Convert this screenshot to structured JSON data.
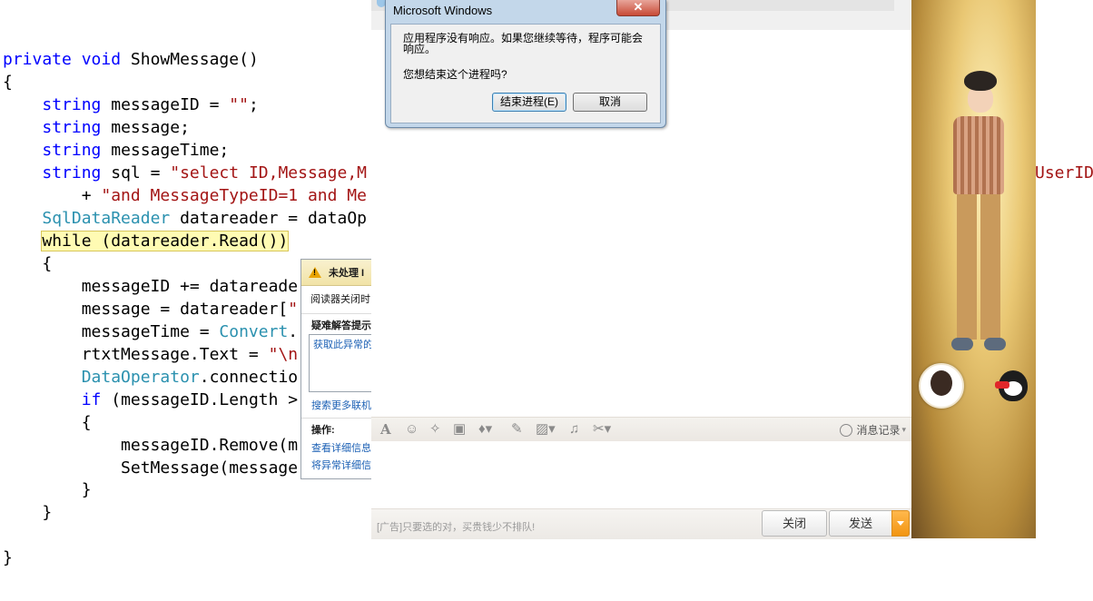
{
  "code": {
    "lines": [
      [
        {
          "t": "private",
          "c": "kw"
        },
        {
          "t": " "
        },
        {
          "t": "void",
          "c": "kw"
        },
        {
          "t": " ShowMessage()"
        }
      ],
      [
        {
          "t": "{"
        }
      ],
      [
        {
          "t": "    "
        },
        {
          "t": "string",
          "c": "kw"
        },
        {
          "t": " messageID = "
        },
        {
          "t": "\"\"",
          "c": "st"
        },
        {
          "t": ";"
        }
      ],
      [
        {
          "t": "    "
        },
        {
          "t": "string",
          "c": "kw"
        },
        {
          "t": " message;"
        }
      ],
      [
        {
          "t": "    "
        },
        {
          "t": "string",
          "c": "kw"
        },
        {
          "t": " messageTime;"
        }
      ],
      [
        {
          "t": "    "
        },
        {
          "t": "string",
          "c": "kw"
        },
        {
          "t": " sql = "
        },
        {
          "t": "\"select ID,Message,M",
          "c": "st"
        }
      ],
      [
        {
          "t": "        + "
        },
        {
          "t": "\"and MessageTypeID=1 and Me",
          "c": "st"
        }
      ],
      [
        {
          "t": "    "
        },
        {
          "t": "SqlDataReader",
          "c": "ty"
        },
        {
          "t": " datareader = dataOp"
        }
      ],
      [
        {
          "t": "    "
        },
        {
          "t": "while (datareader.Read())",
          "c": "hl"
        }
      ],
      [
        {
          "t": "    {"
        }
      ],
      [
        {
          "t": "        messageID += datareade"
        }
      ],
      [
        {
          "t": "        message = datareader["
        },
        {
          "t": "\"",
          "c": "st"
        }
      ],
      [
        {
          "t": "        messageTime = "
        },
        {
          "t": "Convert",
          "c": "ty"
        },
        {
          "t": "."
        }
      ],
      [
        {
          "t": "        rtxtMessage.Text = "
        },
        {
          "t": "\"\\n",
          "c": "st"
        }
      ],
      [
        {
          "t": "        "
        },
        {
          "t": "DataOperator",
          "c": "ty"
        },
        {
          "t": ".connectio"
        }
      ],
      [
        {
          "t": "        "
        },
        {
          "t": "if",
          "c": "kw"
        },
        {
          "t": " (messageID.Length >"
        }
      ],
      [
        {
          "t": "        {"
        }
      ],
      [
        {
          "t": "            messageID.Remove(m"
        }
      ],
      [
        {
          "t": "            SetMessage(message"
        }
      ],
      [
        {
          "t": "        }"
        }
      ],
      [
        {
          "t": "    }"
        }
      ],
      [
        {
          "t": ""
        }
      ],
      [
        {
          "t": "}"
        }
      ]
    ],
    "line_tops": [
      53,
      78,
      103,
      128,
      153,
      178,
      203,
      228,
      253,
      278,
      303,
      328,
      353,
      378,
      403,
      428,
      453,
      478,
      503,
      527,
      552,
      577,
      602
    ],
    "stray_text": "UserID="
  },
  "exception": {
    "title": "未处理 I",
    "message": "阅读器关闭时",
    "troubleshooting_heading": "疑难解答提示",
    "tip_link": "获取此异常的",
    "search_link": "搜索更多联机",
    "actions_heading": "操作:",
    "action_details": "查看详细信息",
    "action_copy": "将异常详细信"
  },
  "dialog": {
    "title": "Microsoft Windows",
    "close_glyph": "✕",
    "message": "应用程序没有响应。如果您继续等待，程序可能会响应。",
    "question": "您想结束这个进程吗?",
    "end_button": "结束进程(E)",
    "cancel_button": "取消"
  },
  "chat": {
    "toolbar_icons": [
      "font-icon",
      "emoji-icon",
      "shake-icon",
      "screenshot-icon",
      "voice-icon",
      "edit-icon",
      "image-icon",
      "music-icon",
      "scissors-icon"
    ],
    "history_label": "消息记录",
    "ad_text": "[广告]只要选的对，买贵钱少不排队!",
    "close_button": "关闭",
    "send_button": "发送"
  }
}
